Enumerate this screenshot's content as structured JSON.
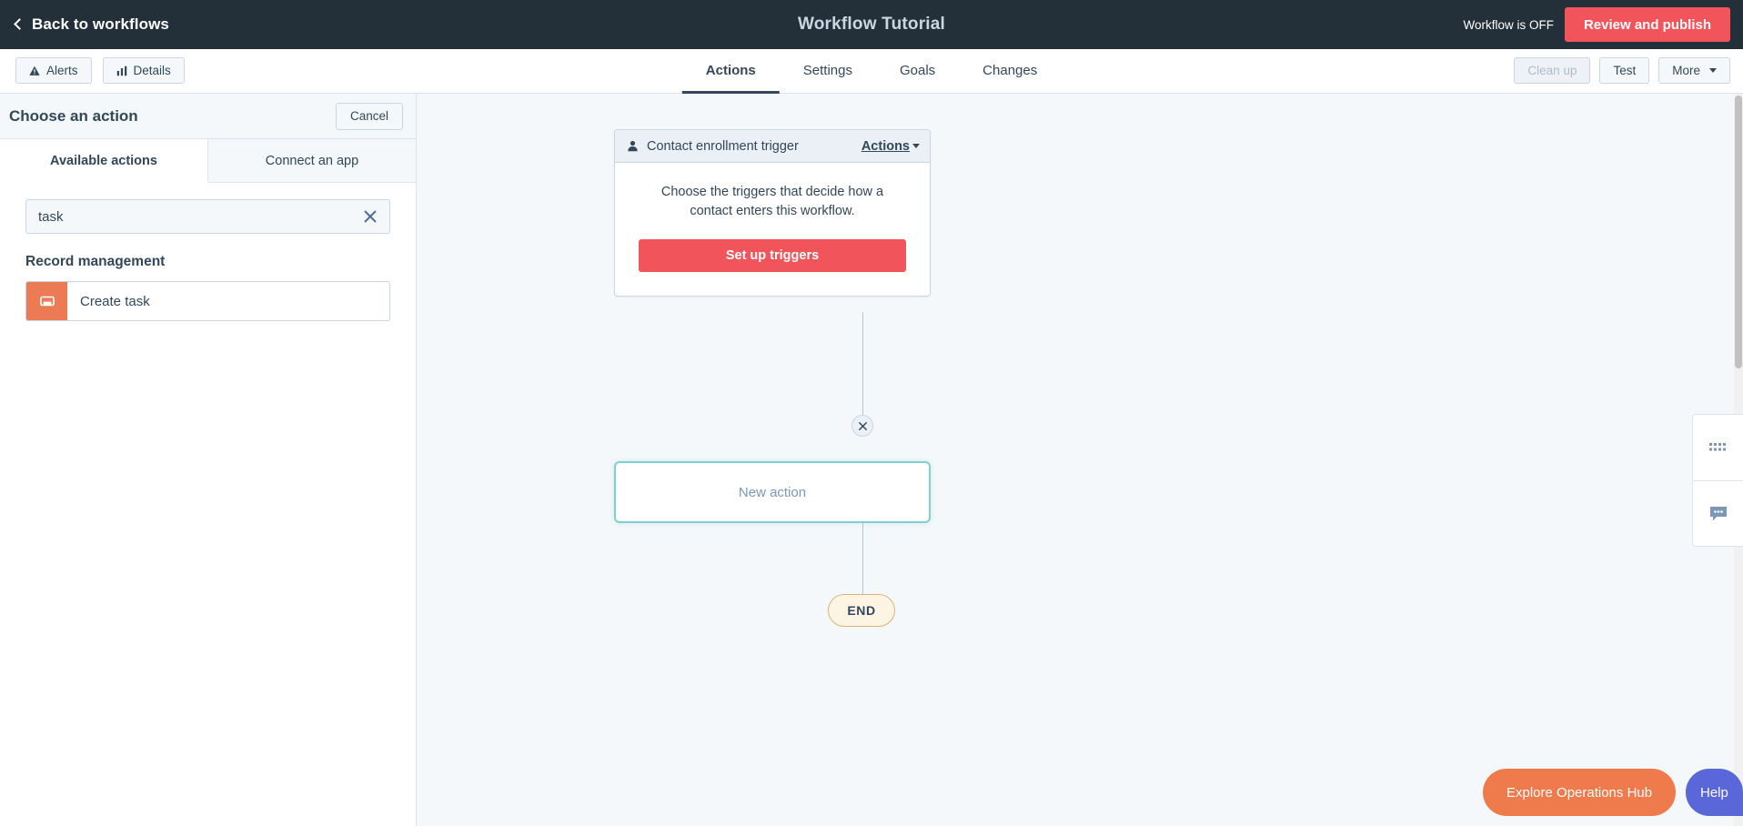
{
  "topbar": {
    "back_label": "Back to workflows",
    "back_icon": "chevron-left-icon",
    "workflow_title": "Workflow Tutorial",
    "workflow_status": "Workflow is OFF",
    "publish_label": "Review and publish",
    "publish_color": "#f2545b"
  },
  "tabbar": {
    "left_buttons": [
      {
        "label": "Alerts",
        "icon": "alert-triangle-icon"
      },
      {
        "label": "Details",
        "icon": "bar-chart-icon"
      }
    ],
    "tabs": [
      {
        "label": "Actions",
        "active": true
      },
      {
        "label": "Settings",
        "active": false
      },
      {
        "label": "Goals",
        "active": false
      },
      {
        "label": "Changes",
        "active": false
      }
    ],
    "right_buttons": [
      {
        "label": "Clean up",
        "disabled": true
      },
      {
        "label": "Test",
        "disabled": false
      },
      {
        "label": "More",
        "disabled": false,
        "caret": true
      }
    ]
  },
  "panel": {
    "title": "Choose an action",
    "cancel_label": "Cancel",
    "tabs": [
      {
        "label": "Available actions",
        "active": true
      },
      {
        "label": "Connect an app",
        "active": false
      }
    ],
    "search": {
      "value": "task",
      "placeholder": "Search actions",
      "clear_icon": "close-icon"
    },
    "groups": [
      {
        "title": "Record management",
        "items": [
          {
            "label": "Create task",
            "icon": "task-card-icon",
            "icon_color": "#ec7a54"
          }
        ]
      }
    ]
  },
  "canvas": {
    "trigger": {
      "header_icon": "contact-person-icon",
      "header_label": "Contact enrollment trigger",
      "actions_label": "Actions",
      "actions_caret_icon": "chevron-down-icon",
      "description": "Choose the triggers that decide how a contact enters this workflow.",
      "button_label": "Set up triggers",
      "button_color": "#f2545b"
    },
    "plus_node_icon": "close-icon",
    "new_action_label": "New action",
    "new_action_border_color": "#7fd1cd",
    "end_label": "END"
  },
  "dock": {
    "buttons": [
      {
        "icon": "grid-dots-icon"
      },
      {
        "icon": "comment-bubble-icon"
      }
    ]
  },
  "floating": {
    "ops_hub_label": "Explore Operations Hub",
    "ops_hub_color": "#ef7b4d",
    "help_label": "Help",
    "help_color": "#5a67d8"
  }
}
